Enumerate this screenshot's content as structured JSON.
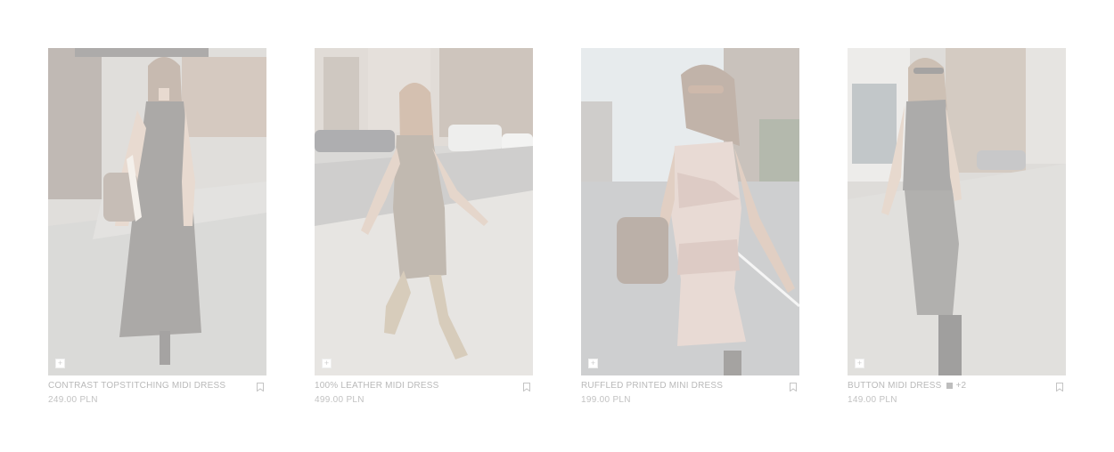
{
  "products": [
    {
      "name": "CONTRAST TOPSTITCHING MIDI DRESS",
      "price": "249.00 PLN",
      "add_symbol": "+",
      "icons": {
        "add": "plus-icon",
        "save": "bookmark-icon"
      },
      "colors": {
        "dress": "#3a3530",
        "background": "#8a8782"
      }
    },
    {
      "name": "100% LEATHER MIDI DRESS",
      "price": "499.00 PLN",
      "add_symbol": "+",
      "icons": {
        "add": "plus-icon",
        "save": "bookmark-icon"
      },
      "colors": {
        "dress": "#6e5a45",
        "background": "#9a958e"
      }
    },
    {
      "name": "RUFFLED PRINTED MINI DRESS",
      "price": "199.00 PLN",
      "add_symbol": "+",
      "icons": {
        "add": "plus-icon",
        "save": "bookmark-icon"
      },
      "colors": {
        "dress": "#c9a99a",
        "background": "#a3a4a5"
      }
    },
    {
      "name": "BUTTON MIDI DRESS",
      "price": "149.00 PLN",
      "extra_colors": "+2",
      "add_symbol": "+",
      "icons": {
        "add": "plus-icon",
        "save": "bookmark-icon"
      },
      "colors": {
        "dress": "#3c3936",
        "background": "#a6a29c"
      }
    }
  ],
  "ui_colors": {
    "text": "#b9b9b9",
    "swatch": "#bdbdbd"
  }
}
